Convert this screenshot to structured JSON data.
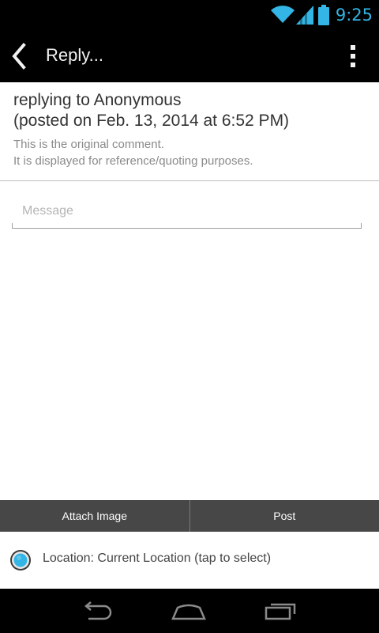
{
  "status_bar": {
    "time": "9:25",
    "icons": [
      "wifi-icon",
      "signal-icon",
      "battery-icon"
    ],
    "accent_color": "#33b5e5"
  },
  "action_bar": {
    "title": "Reply...",
    "back_icon": "chevron-left-icon",
    "overflow_icon": "more-vertical-icon"
  },
  "quote": {
    "replying_to": "replying to Anonymous",
    "posted_on": "(posted on Feb. 13, 2014 at 6:52 PM)",
    "original_line_1": "This is the original comment.",
    "original_line_2": "It is displayed for reference/quoting purposes."
  },
  "message": {
    "placeholder": "Message",
    "value": ""
  },
  "buttons": {
    "attach_image": "Attach Image",
    "post": "Post"
  },
  "location": {
    "label": "Location: Current Location (tap to select)",
    "selected": true
  },
  "nav_bar": {
    "icons": [
      "back-nav-icon",
      "home-nav-icon",
      "recents-nav-icon"
    ]
  }
}
